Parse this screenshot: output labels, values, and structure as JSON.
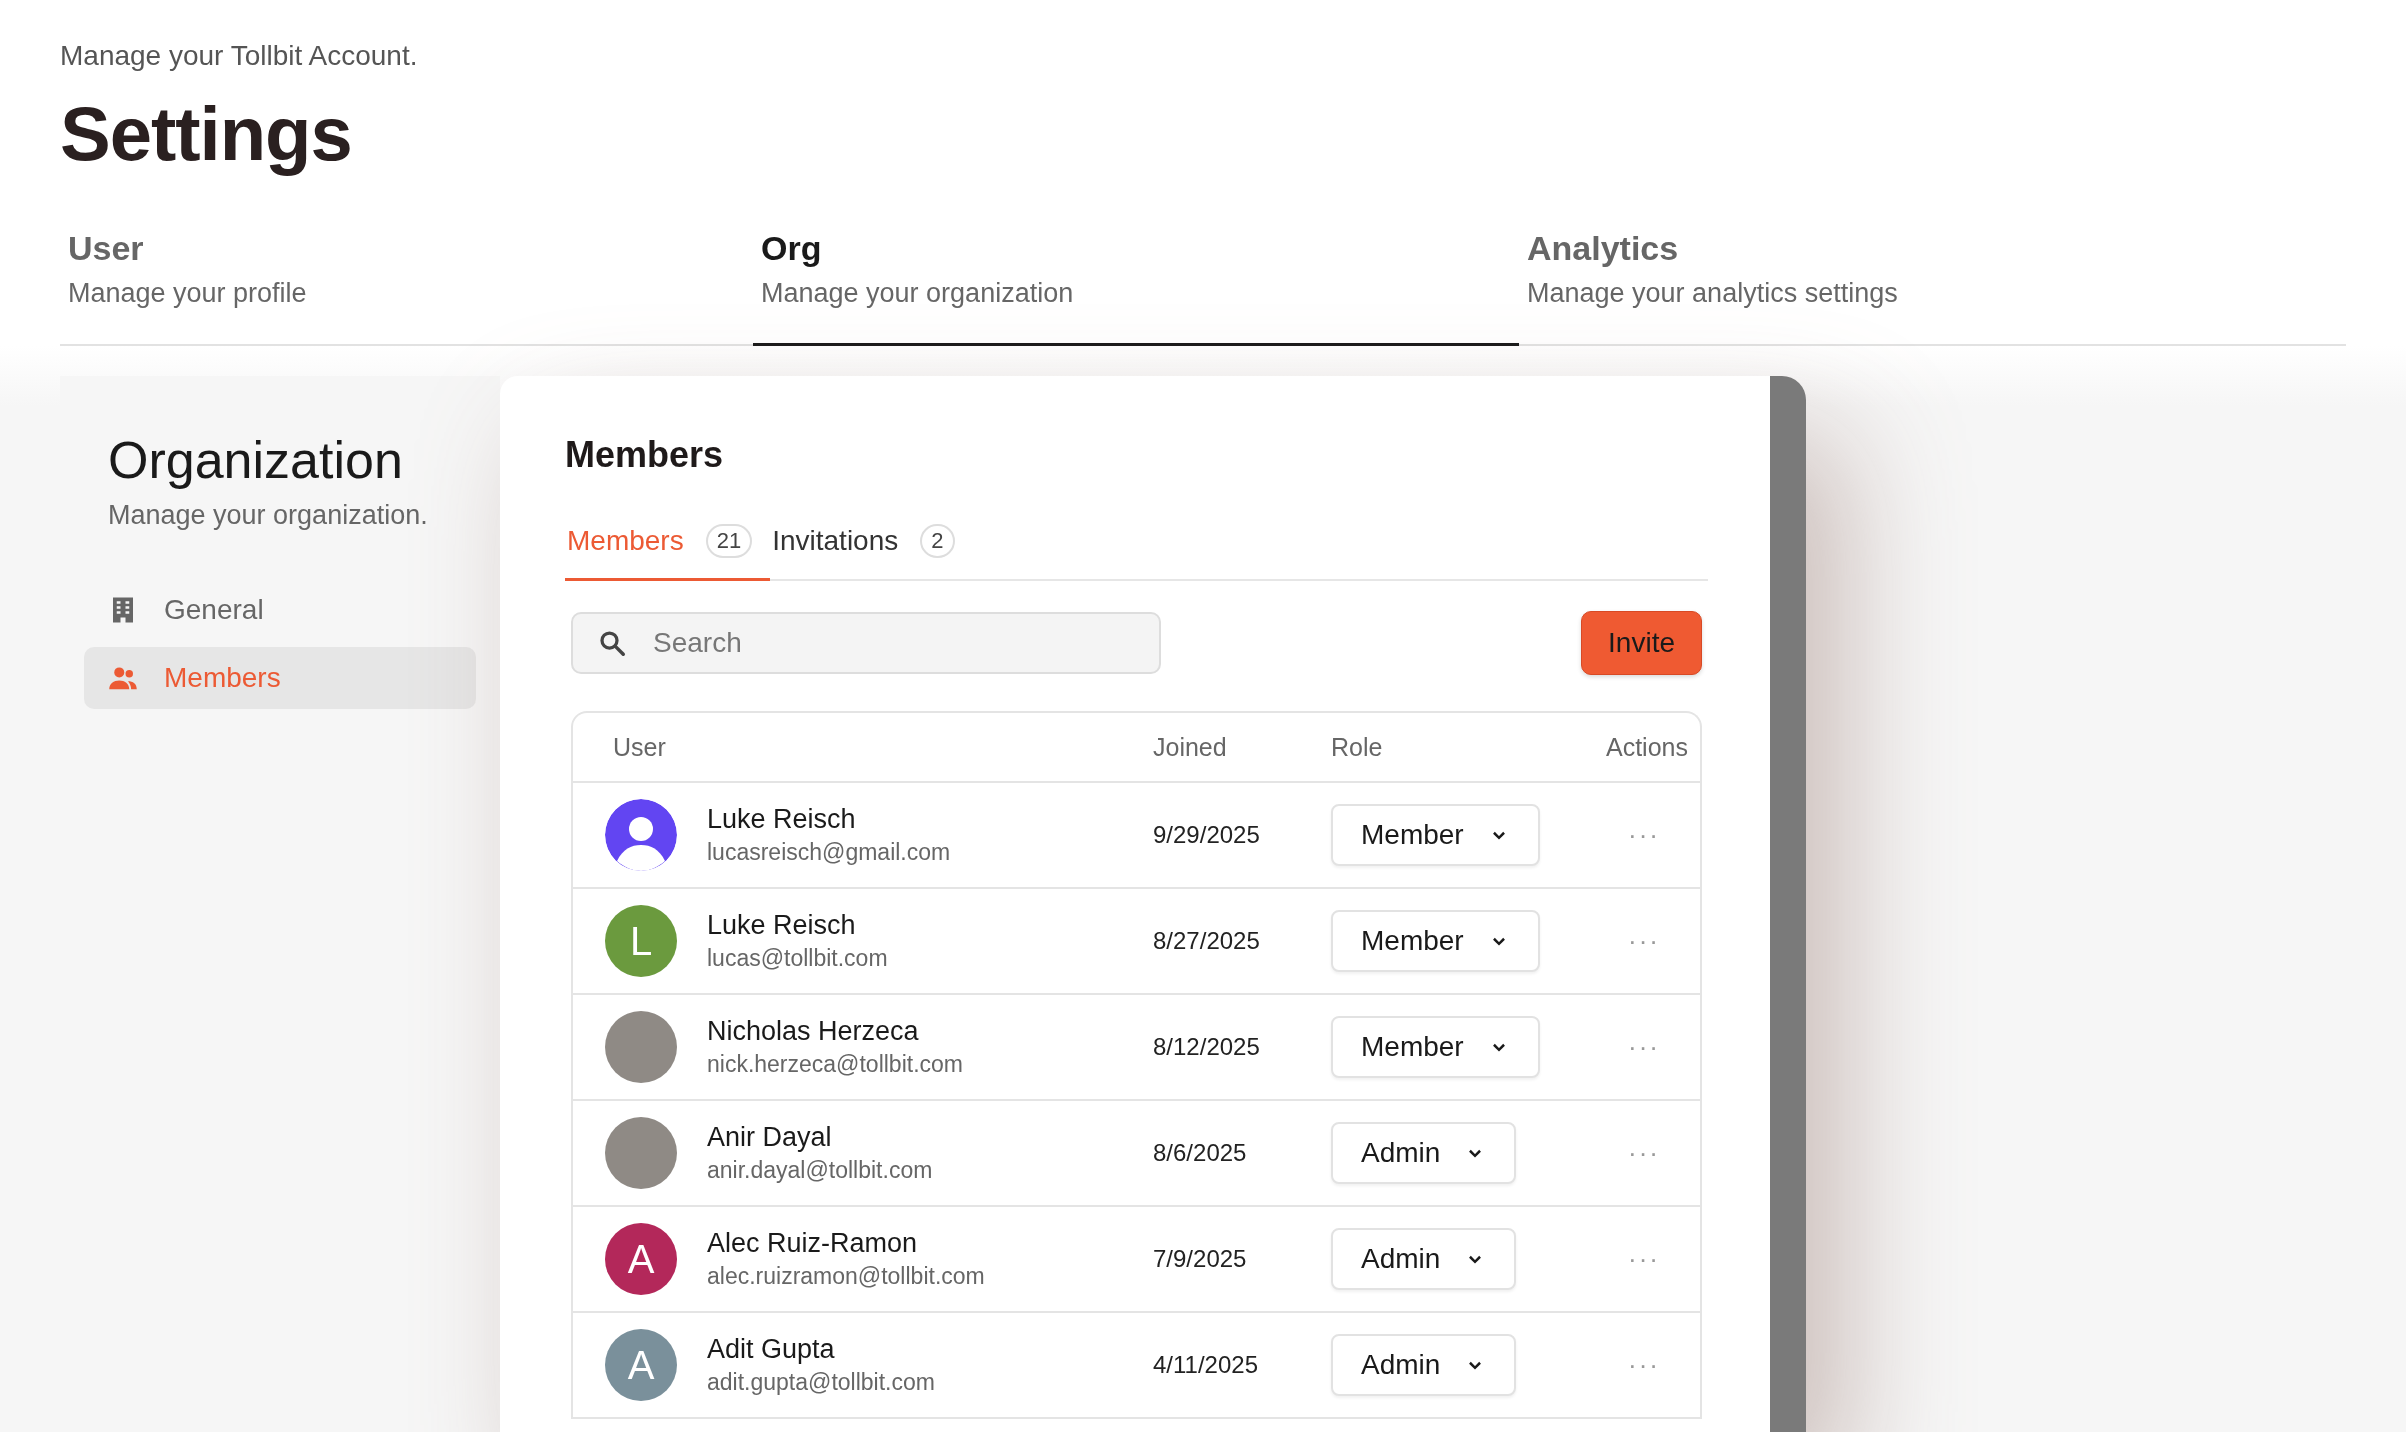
{
  "header": {
    "subtitle": "Manage your Tollbit Account.",
    "title": "Settings"
  },
  "tabs": [
    {
      "label": "User",
      "description": "Manage your profile",
      "selected": false
    },
    {
      "label": "Org",
      "description": "Manage your organization",
      "selected": true
    },
    {
      "label": "Analytics",
      "description": "Manage your analytics settings",
      "selected": false
    }
  ],
  "sidebar": {
    "title": "Organization",
    "subtitle": "Manage your organization.",
    "items": [
      {
        "label": "General",
        "kind": "building",
        "selected": false
      },
      {
        "label": "Members",
        "kind": "people",
        "selected": true
      }
    ]
  },
  "panel": {
    "title": "Members",
    "subtabs": [
      {
        "label": "Members",
        "count": "21",
        "selected": true
      },
      {
        "label": "Invitations",
        "count": "2",
        "selected": false
      }
    ],
    "search": {
      "placeholder": "Search"
    },
    "invite_button": "Invite",
    "table": {
      "columns": [
        "User",
        "Joined",
        "Role",
        "Actions"
      ],
      "rows": [
        {
          "avatar": {
            "kind": "silhouette",
            "color": "#6245f2"
          },
          "name": "Luke Reisch",
          "email": "lucasreisch@gmail.com",
          "joined": "9/29/2025",
          "role": "Member",
          "actions": "···"
        },
        {
          "avatar": {
            "kind": "letter",
            "letter": "L",
            "color": "#6b9a3e"
          },
          "name": "Luke Reisch",
          "email": "lucas@tollbit.com",
          "joined": "8/27/2025",
          "role": "Member",
          "actions": "···"
        },
        {
          "avatar": {
            "kind": "photo"
          },
          "name": "Nicholas Herzeca",
          "email": "nick.herzeca@tollbit.com",
          "joined": "8/12/2025",
          "role": "Member",
          "actions": "···"
        },
        {
          "avatar": {
            "kind": "photo"
          },
          "name": "Anir Dayal",
          "email": "anir.dayal@tollbit.com",
          "joined": "8/6/2025",
          "role": "Admin",
          "actions": "···"
        },
        {
          "avatar": {
            "kind": "letter",
            "letter": "A",
            "color": "#b3285a"
          },
          "name": "Alec Ruiz-Ramon",
          "email": "alec.ruizramon@tollbit.com",
          "joined": "7/9/2025",
          "role": "Admin",
          "actions": "···"
        },
        {
          "avatar": {
            "kind": "letter",
            "letter": "A",
            "color": "#7a909b"
          },
          "name": "Adit Gupta",
          "email": "adit.gupta@tollbit.com",
          "joined": "4/11/2025",
          "role": "Admin",
          "actions": "···"
        }
      ]
    }
  }
}
